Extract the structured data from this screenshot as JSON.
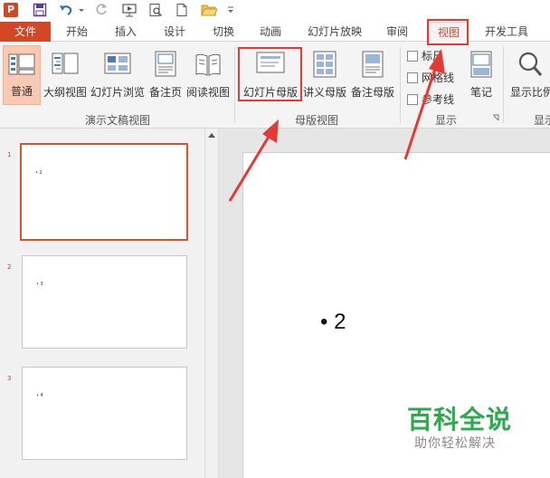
{
  "quick_access": {
    "app_icon": "powerpoint-icon",
    "app_letter": "P",
    "icons": [
      "save-icon",
      "undo-icon",
      "redo-icon",
      "from-beginning-icon",
      "print-preview-icon",
      "new-icon",
      "open-icon",
      "customize-arrow-icon"
    ]
  },
  "tabs": {
    "file": "文件",
    "home": "开始",
    "insert": "插入",
    "design": "设计",
    "transitions": "切换",
    "animations": "动画",
    "slideshow": "幻灯片放映",
    "review": "审阅",
    "view": "视图",
    "developer": "开发工具"
  },
  "ribbon": {
    "presentation_views": {
      "normal": "普通",
      "outline": "大纲视图",
      "sorter": "幻灯片浏览",
      "notes_page": "备注页",
      "reading": "阅读视图",
      "group": "演示文稿视图"
    },
    "master_views": {
      "slide_master": "幻灯片母版",
      "handout_master": "讲义母版",
      "notes_master": "备注母版",
      "group": "母版视图"
    },
    "show": {
      "ruler": "标尺",
      "gridlines": "网格线",
      "guides": "参考线",
      "notes": "笔记",
      "group": "显示"
    },
    "zoom": {
      "zoom_label": "显示比例",
      "group": "显示"
    }
  },
  "slides": [
    {
      "num": "1",
      "text": "• 2"
    },
    {
      "num": "2",
      "text": "• 3"
    },
    {
      "num": "3",
      "text": "• 4"
    }
  ],
  "main_slide": {
    "bullet_text": "• 2"
  },
  "watermark": {
    "title": "百科全说",
    "subtitle": "助你轻松解决"
  },
  "colors": {
    "accent": "#d24726",
    "highlight": "#e53935",
    "watermark_green": "#2fa84f"
  }
}
